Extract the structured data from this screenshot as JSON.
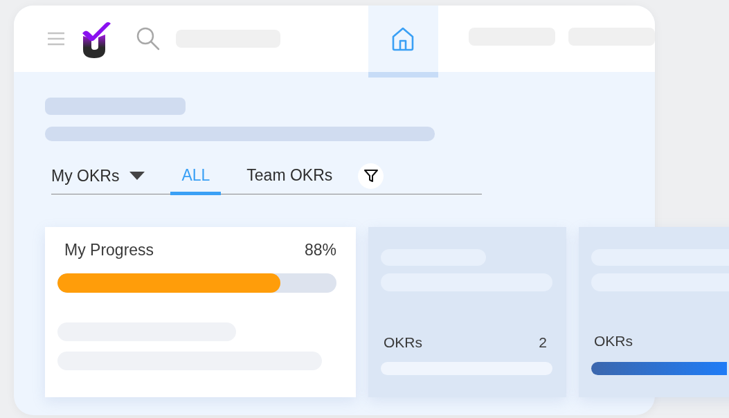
{
  "header": {
    "home_tab": {
      "selected": true
    }
  },
  "filter_bar": {
    "dropdown": "My OKRs",
    "tabs": [
      {
        "label": "ALL",
        "selected": true
      },
      {
        "label": "Team OKRs",
        "selected": false
      }
    ]
  },
  "cards": [
    {
      "kind": "progress",
      "title": "My Progress",
      "value": "88%",
      "level": 0.8
    },
    {
      "kind": "count",
      "label": "OKRs",
      "value": "2"
    },
    {
      "kind": "bar",
      "label": "OKRs",
      "level": 1
    }
  ]
}
